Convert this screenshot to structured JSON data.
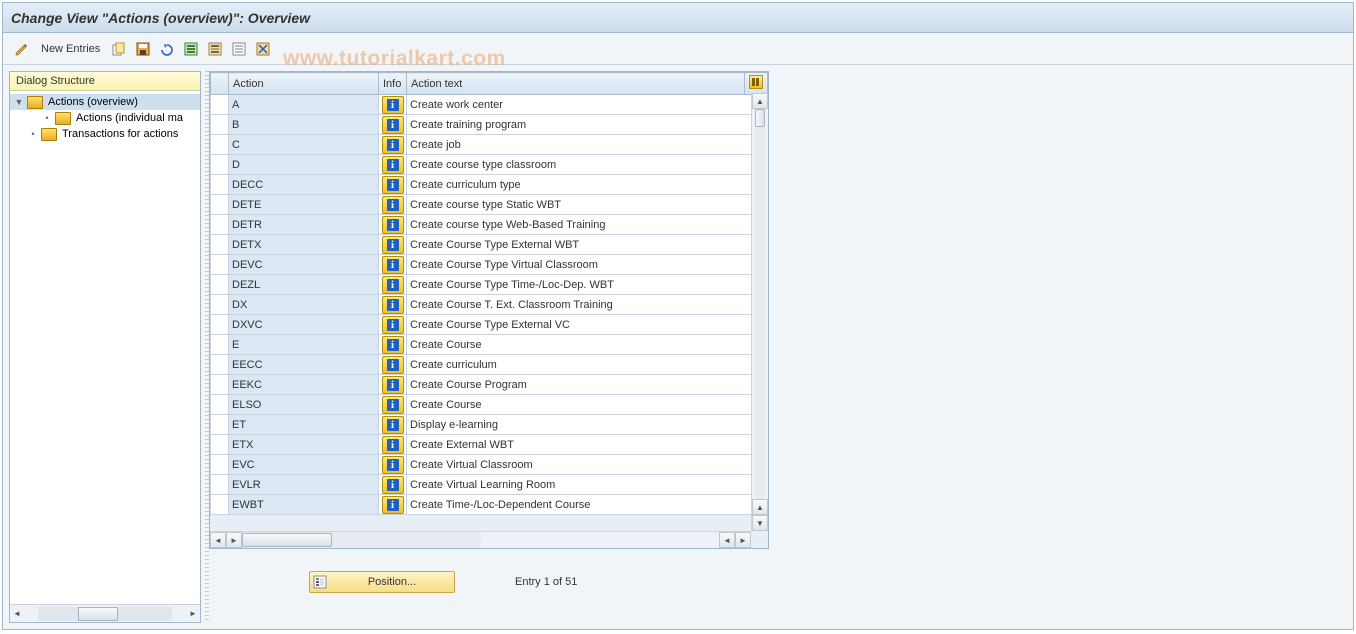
{
  "title": "Change View \"Actions (overview)\": Overview",
  "watermark": "www.tutorialkart.com",
  "toolbar": {
    "new_entries": "New Entries"
  },
  "dialog": {
    "header": "Dialog Structure",
    "node_actions_overview": "Actions (overview)",
    "node_actions_individual": "Actions (individual ma",
    "node_transactions": "Transactions for actions"
  },
  "table": {
    "headers": {
      "action": "Action",
      "info": "Info",
      "action_text": "Action text"
    },
    "rows": [
      {
        "action": "A",
        "text": "Create work center"
      },
      {
        "action": "B",
        "text": "Create training program"
      },
      {
        "action": "C",
        "text": "Create job"
      },
      {
        "action": "D",
        "text": "Create course type classroom"
      },
      {
        "action": "DECC",
        "text": "Create curriculum type"
      },
      {
        "action": "DETE",
        "text": "Create course type Static WBT"
      },
      {
        "action": "DETR",
        "text": "Create course type Web-Based Training"
      },
      {
        "action": "DETX",
        "text": "Create Course Type External WBT"
      },
      {
        "action": "DEVC",
        "text": "Create Course Type Virtual Classroom"
      },
      {
        "action": "DEZL",
        "text": "Create Course Type Time-/Loc-Dep. WBT"
      },
      {
        "action": "DX",
        "text": "Create Course T. Ext. Classroom Training"
      },
      {
        "action": "DXVC",
        "text": "Create Course Type External VC"
      },
      {
        "action": "E",
        "text": "Create Course"
      },
      {
        "action": "EECC",
        "text": "Create curriculum"
      },
      {
        "action": "EEKC",
        "text": "Create Course Program"
      },
      {
        "action": "ELSO",
        "text": "Create Course"
      },
      {
        "action": "ET",
        "text": "Display e-learning"
      },
      {
        "action": "ETX",
        "text": "Create External WBT"
      },
      {
        "action": "EVC",
        "text": "Create Virtual Classroom"
      },
      {
        "action": "EVLR",
        "text": "Create Virtual Learning Room"
      },
      {
        "action": "EWBT",
        "text": "Create Time-/Loc-Dependent Course"
      }
    ]
  },
  "footer": {
    "position_label": "Position...",
    "entry_text": "Entry 1 of 51"
  }
}
